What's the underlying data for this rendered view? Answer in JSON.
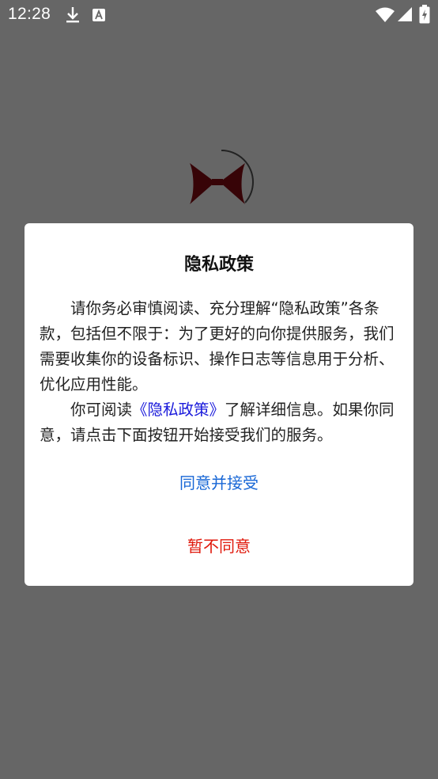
{
  "status_bar": {
    "time": "12:28",
    "icons": [
      "download-icon",
      "app-notification-icon",
      "wifi-icon",
      "signal-icon",
      "battery-icon"
    ]
  },
  "splash": {
    "logo": "app-logo",
    "colors": {
      "logo": "#8b0a12",
      "spinner": "#555555"
    }
  },
  "dialog": {
    "title": "隐私政策",
    "paragraph1": "请你务必审慎阅读、充分理解“隐私政策”各条款，包括但不限于：为了更好的向你提供服务，我们需要收集你的设备标识、操作日志等信息用于分析、优化应用性能。",
    "paragraph2_before": "你可阅读",
    "paragraph2_link": "《隐私政策》",
    "paragraph2_after": "了解详细信息。如果你同意，请点击下面按钮开始接受我们的服务。",
    "agree_label": "同意并接受",
    "decline_label": "暂不同意",
    "colors": {
      "agree": "#1867d6",
      "decline": "#e0190c",
      "link": "#1a1adb"
    }
  }
}
